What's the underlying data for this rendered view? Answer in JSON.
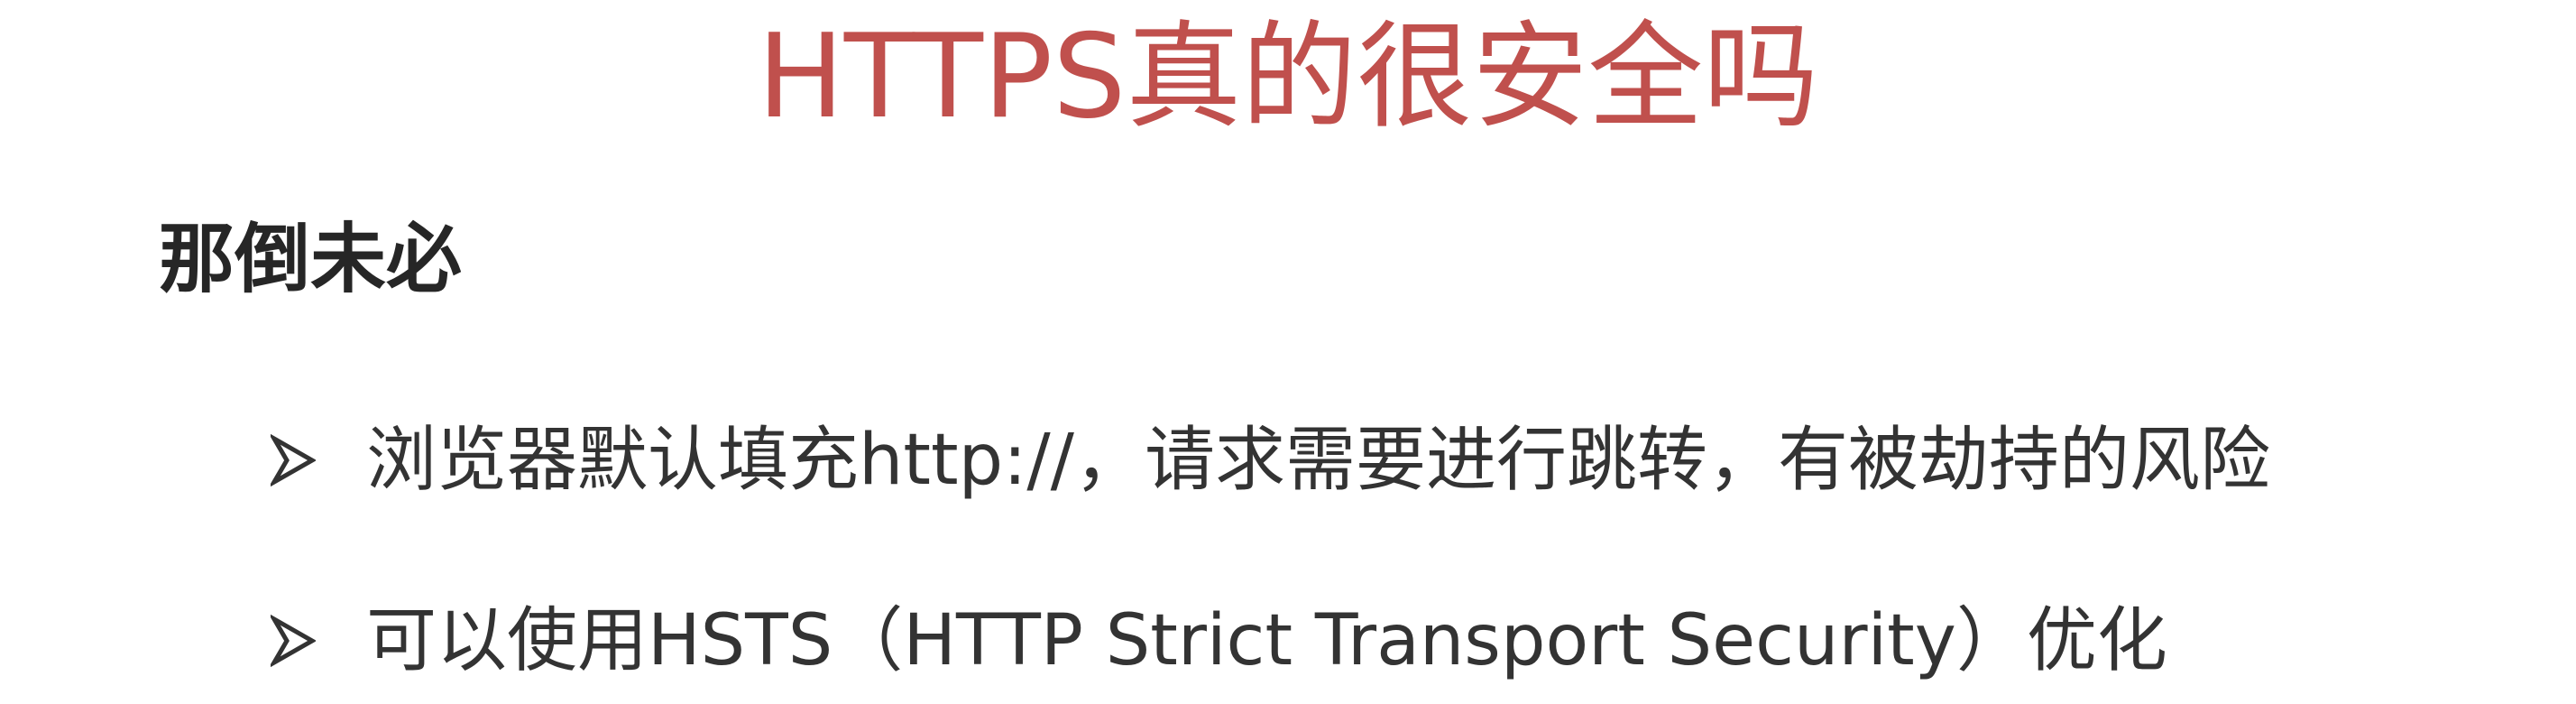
{
  "slide": {
    "title": "HTTPS真的很安全吗",
    "subtitle": "那倒未必",
    "bullets": [
      {
        "icon": "arrow-bullet-icon",
        "text": "浏览器默认填充http://，请求需要进行跳转，有被劫持的风险"
      },
      {
        "icon": "arrow-bullet-icon",
        "text": "可以使用HSTS（HTTP Strict Transport Security）优化"
      }
    ]
  },
  "colors": {
    "title": "#c0504d",
    "body": "#333333",
    "background": "#ffffff"
  }
}
